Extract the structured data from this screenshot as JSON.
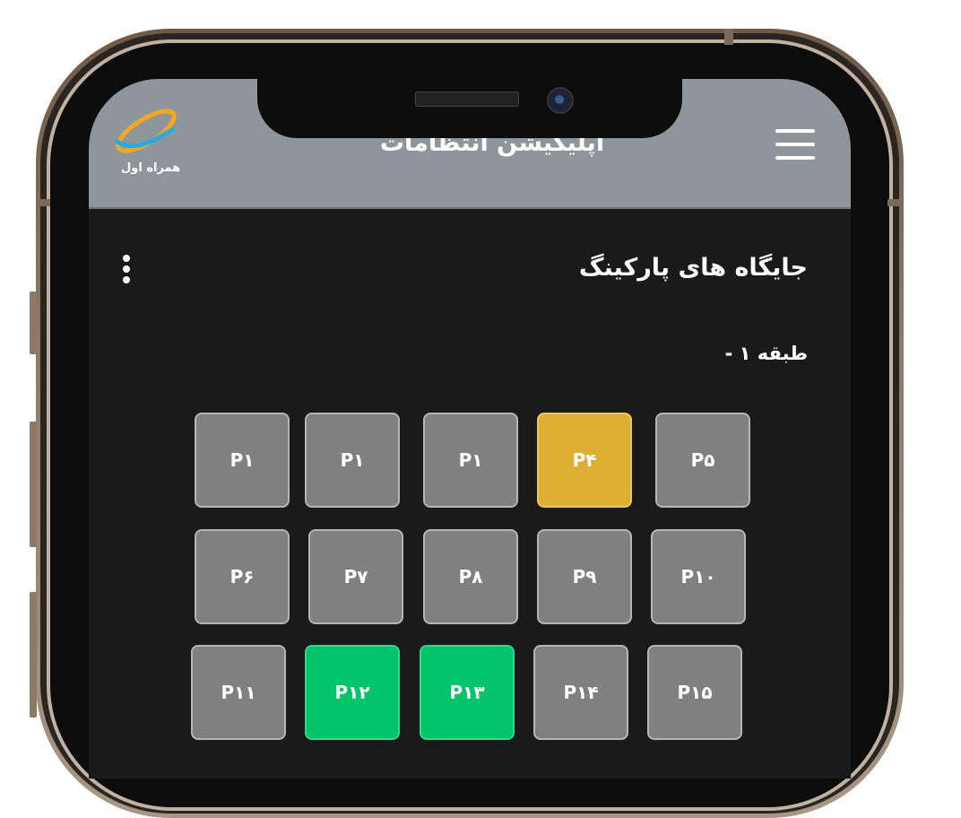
{
  "header": {
    "title": "اپلیکیشن انتظامات",
    "logo_text": "همراه اول"
  },
  "page": {
    "title": "جایگاه های پارکینگ",
    "floor_label": "طبقه ۱ -"
  },
  "parking_spots": [
    {
      "label": "P۱",
      "status": "occupied"
    },
    {
      "label": "P۱",
      "status": "occupied"
    },
    {
      "label": "P۱",
      "status": "occupied"
    },
    {
      "label": "P۴",
      "status": "reserved"
    },
    {
      "label": "P۵",
      "status": "occupied"
    },
    {
      "label": "P۶",
      "status": "occupied"
    },
    {
      "label": "P۷",
      "status": "occupied"
    },
    {
      "label": "P۸",
      "status": "occupied"
    },
    {
      "label": "P۹",
      "status": "occupied"
    },
    {
      "label": "P۱۰",
      "status": "occupied"
    },
    {
      "label": "P۱۱",
      "status": "occupied"
    },
    {
      "label": "P۱۲",
      "status": "free"
    },
    {
      "label": "P۱۳",
      "status": "free"
    },
    {
      "label": "P۱۴",
      "status": "occupied"
    },
    {
      "label": "P۱۵",
      "status": "occupied"
    }
  ],
  "colors": {
    "header": "#8f969b",
    "background": "#1a1a1a",
    "occupied": "#808080",
    "reserved": "#ddaf32",
    "free": "#03c46b"
  },
  "icons": {
    "menu": "hamburger-menu-icon",
    "more": "kebab-menu-icon",
    "logo": "hamrah-aval-logo-icon"
  }
}
